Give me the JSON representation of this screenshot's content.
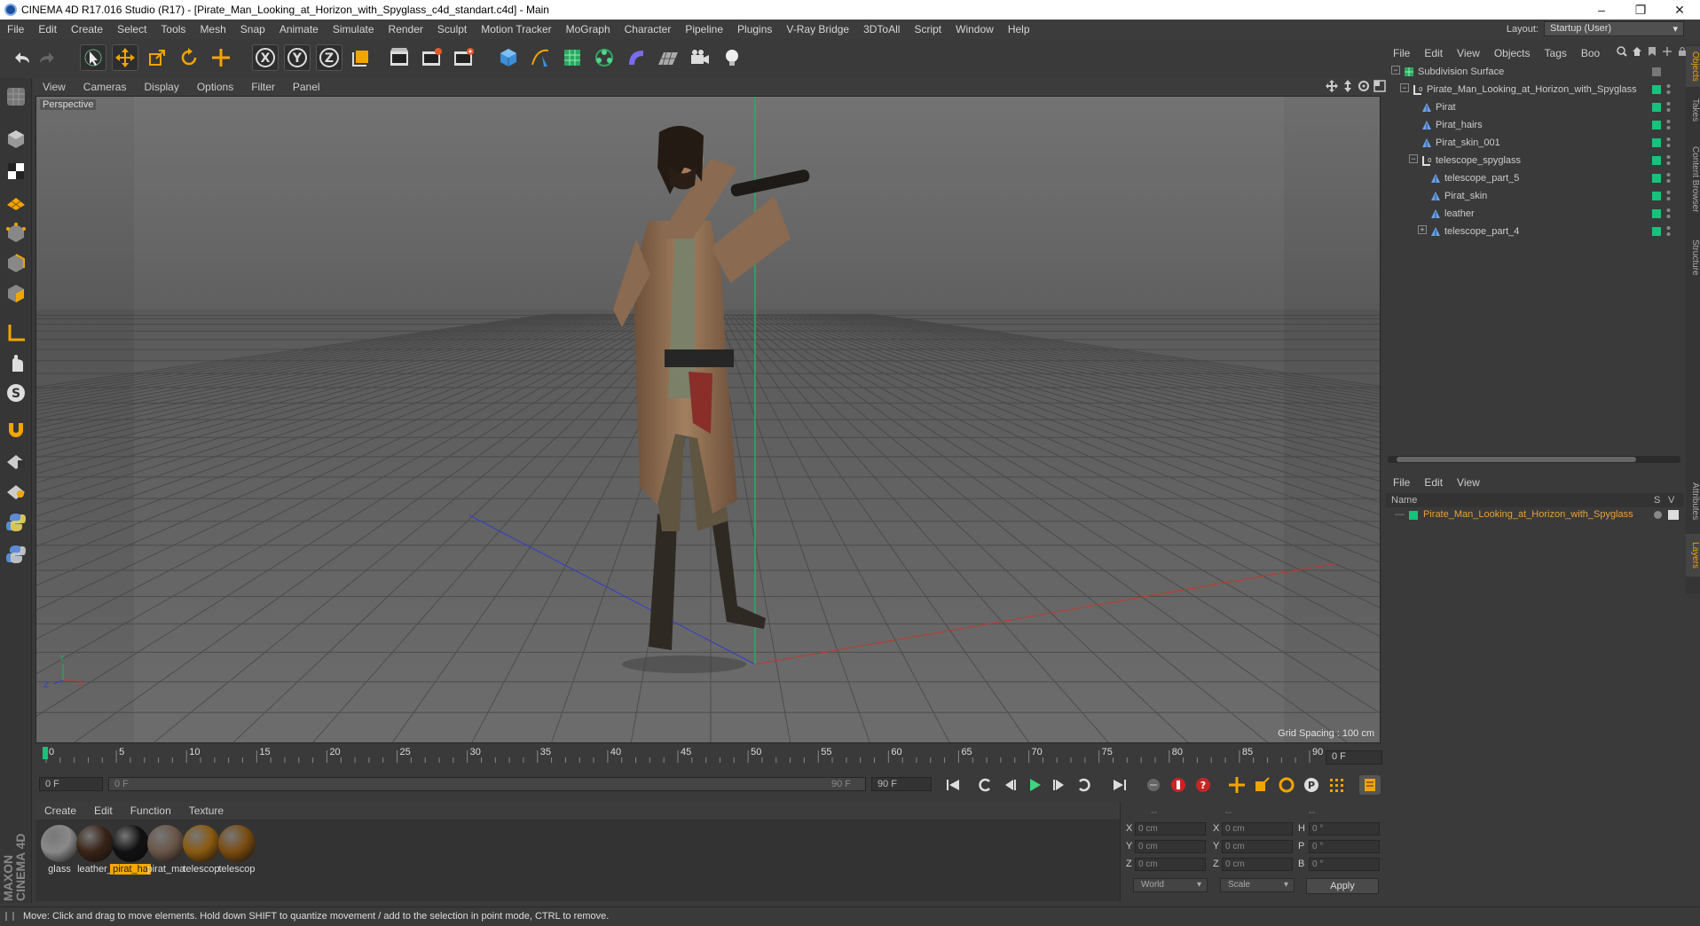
{
  "window": {
    "title": "CINEMA 4D R17.016 Studio (R17) - [Pirate_Man_Looking_at_Horizon_with_Spyglass_c4d_standart.c4d] - Main"
  },
  "menu": [
    "File",
    "Edit",
    "Create",
    "Select",
    "Tools",
    "Mesh",
    "Snap",
    "Animate",
    "Simulate",
    "Render",
    "Sculpt",
    "Motion Tracker",
    "MoGraph",
    "Character",
    "Pipeline",
    "Plugins",
    "V-Ray Bridge",
    "3DToAll",
    "Script",
    "Window",
    "Help"
  ],
  "layout": {
    "label": "Layout:",
    "value": "Startup (User)"
  },
  "viewport": {
    "menu": [
      "View",
      "Cameras",
      "Display",
      "Options",
      "Filter",
      "Panel"
    ],
    "label": "Perspective",
    "grid_spacing": "Grid Spacing : 100 cm"
  },
  "timeline": {
    "ticks": [
      "0",
      "5",
      "10",
      "15",
      "20",
      "25",
      "30",
      "35",
      "40",
      "45",
      "50",
      "55",
      "60",
      "65",
      "70",
      "75",
      "80",
      "85",
      "90"
    ],
    "current_frame": "0 F",
    "start_field": "0 F",
    "slider_start": "0 F",
    "slider_end": "90 F",
    "end_field": "90 F"
  },
  "materials": {
    "menu": [
      "Create",
      "Edit",
      "Function",
      "Texture"
    ],
    "items": [
      {
        "name": "glass",
        "color": "#8a8a8a"
      },
      {
        "name": "leather_",
        "color": "#3a2418"
      },
      {
        "name": "pirat_ha",
        "color": "#111111",
        "selected": true
      },
      {
        "name": "pirat_ma",
        "color": "#6a5548"
      },
      {
        "name": "telescop",
        "color": "#8a5a10"
      },
      {
        "name": "telescop",
        "color": "#7a4c10"
      }
    ]
  },
  "coordinates": {
    "headers": [
      "--",
      "--",
      "--"
    ],
    "rows": [
      {
        "a": "X",
        "av": "0 cm",
        "b": "X",
        "bv": "0 cm",
        "c": "H",
        "cv": "0 °"
      },
      {
        "a": "Y",
        "av": "0 cm",
        "b": "Y",
        "bv": "0 cm",
        "c": "P",
        "cv": "0 °"
      },
      {
        "a": "Z",
        "av": "0 cm",
        "b": "Z",
        "bv": "0 cm",
        "c": "B",
        "cv": "0 °"
      }
    ],
    "mode": "World",
    "transform": "Scale",
    "apply": "Apply"
  },
  "objects": {
    "menu": [
      "File",
      "Edit",
      "View",
      "Objects",
      "Tags",
      "Boo"
    ],
    "tree": [
      {
        "name": "Subdivision Surface",
        "indent": 0,
        "type": "subdiv",
        "expander": "−"
      },
      {
        "name": "Pirate_Man_Looking_at_Horizon_with_Spyglass",
        "indent": 1,
        "type": "null",
        "expander": "−"
      },
      {
        "name": "Pirat",
        "indent": 2,
        "type": "mesh",
        "expander": ""
      },
      {
        "name": "Pirat_hairs",
        "indent": 2,
        "type": "mesh",
        "expander": ""
      },
      {
        "name": "Pirat_skin_001",
        "indent": 2,
        "type": "mesh",
        "expander": ""
      },
      {
        "name": "telescope_spyglass",
        "indent": 2,
        "type": "null",
        "expander": "−"
      },
      {
        "name": "telescope_part_5",
        "indent": 3,
        "type": "mesh",
        "expander": ""
      },
      {
        "name": "Pirat_skin",
        "indent": 3,
        "type": "mesh",
        "expander": ""
      },
      {
        "name": "leather",
        "indent": 3,
        "type": "mesh",
        "expander": ""
      },
      {
        "name": "telescope_part_4",
        "indent": 3,
        "type": "mesh",
        "expander": "+"
      }
    ]
  },
  "layers": {
    "menu": [
      "File",
      "Edit",
      "View"
    ],
    "header_name": "Name",
    "header_s": "S",
    "header_v": "V",
    "row": "Pirate_Man_Looking_at_Horizon_with_Spyglass",
    "row_color": "#18c27a"
  },
  "side_tabs": [
    "Objects",
    "Takes",
    "Content Browser",
    "Structure",
    "Attributes",
    "Layers"
  ],
  "status": "Move: Click and drag to move elements. Hold down SHIFT to quantize movement / add to the selection in point mode, CTRL to remove.",
  "brand": "MAXON CINEMA 4D",
  "colors": {
    "accent": "#f5a800",
    "layer_green": "#18c27a",
    "x_axis": "#c0392b",
    "y_axis": "#27ae60",
    "z_axis": "#2f3fc9"
  }
}
